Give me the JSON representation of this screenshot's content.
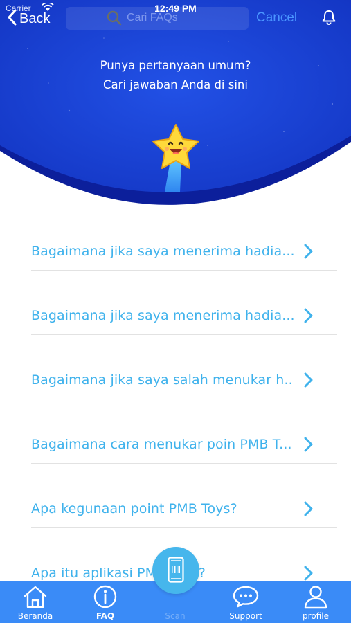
{
  "status_bar": {
    "carrier": "Carrier",
    "time": "12:49 PM"
  },
  "nav": {
    "back_label": "Back",
    "search_placeholder": "Cari FAQs",
    "cancel_label": "Cancel"
  },
  "hero": {
    "title_line1": "Punya pertanyaan umum?",
    "title_line2": "Cari jawaban Anda di sini"
  },
  "faq": [
    {
      "question": "Bagaimana jika saya menerima hadia..."
    },
    {
      "question": "Bagaimana jika saya menerima hadia..."
    },
    {
      "question": "Bagaimana jika saya salah menukar h..."
    },
    {
      "question": "Bagaimana cara menukar poin PMB T..."
    },
    {
      "question": "Apa kegunaan point PMB Toys?"
    },
    {
      "question": "Apa itu aplikasi PMB Toys?"
    }
  ],
  "tabbar": {
    "items": [
      {
        "label": "Beranda",
        "icon": "home-icon"
      },
      {
        "label": "FAQ",
        "icon": "info-icon",
        "active": true
      },
      {
        "label": "Scan",
        "icon": "scan-icon"
      },
      {
        "label": "Support",
        "icon": "chat-icon"
      },
      {
        "label": "profile",
        "icon": "person-icon"
      }
    ]
  },
  "colors": {
    "hero_blue": "#1b3fd1",
    "accent_blue": "#3fb2ec",
    "tabbar_blue": "#3a8bf7",
    "cancel_blue": "#4a95ff"
  }
}
